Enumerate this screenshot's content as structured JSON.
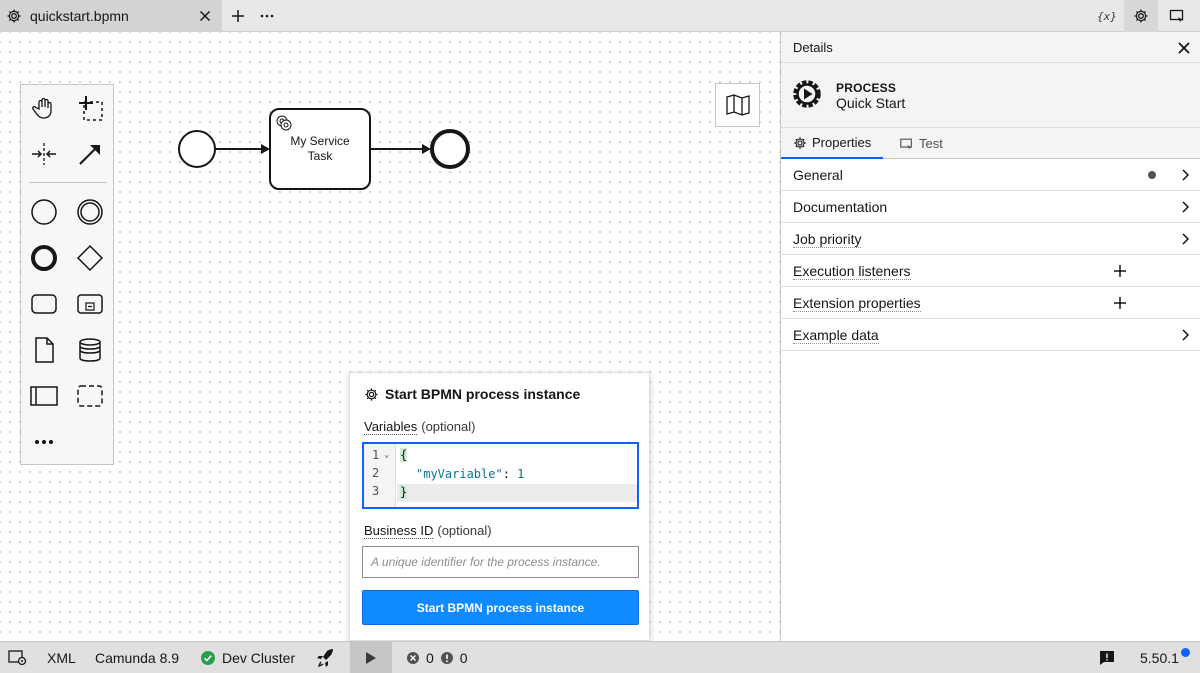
{
  "tab": {
    "title": "quickstart.bpmn"
  },
  "topbar": {
    "variables_label": "{x}"
  },
  "diagram": {
    "service_task_label_line1": "My Service",
    "service_task_label_line2": "Task"
  },
  "panel": {
    "header_title": "Details",
    "element_type": "PROCESS",
    "element_name": "Quick Start",
    "tabs": [
      {
        "label": "Properties"
      },
      {
        "label": "Test"
      }
    ],
    "groups": [
      {
        "label": "General"
      },
      {
        "label": "Documentation"
      },
      {
        "label": "Job priority"
      },
      {
        "label": "Execution listeners"
      },
      {
        "label": "Extension properties"
      },
      {
        "label": "Example data"
      }
    ]
  },
  "popover": {
    "title": "Start BPMN process instance",
    "variables_label": "Variables",
    "variables_optional": "(optional)",
    "code_lines": [
      "{",
      "  \"myVariable\": 1",
      "}"
    ],
    "line_numbers": [
      "1",
      "2",
      "3"
    ],
    "code_key": "\"myVariable\"",
    "code_value": "1",
    "business_id_label": "Business ID",
    "business_id_optional": "(optional)",
    "business_id_placeholder": "A unique identifier for the process instance.",
    "submit_label": "Start BPMN process instance"
  },
  "statusbar": {
    "xml_label": "XML",
    "engine": "Camunda 8.9",
    "cluster": "Dev Cluster",
    "errors": "0",
    "warnings": "0",
    "version": "5.50.1"
  },
  "colors": {
    "accent": "#0f62fe",
    "button": "#0f8bff",
    "success": "#24a148"
  }
}
